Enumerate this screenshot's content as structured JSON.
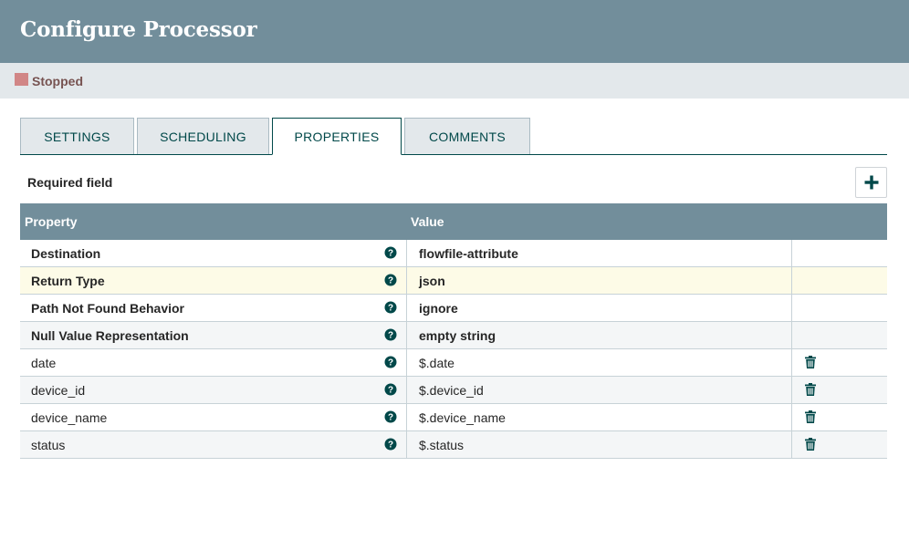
{
  "header": {
    "title": "Configure Processor"
  },
  "status": {
    "text": "Stopped",
    "color": "#d18686"
  },
  "tabs": [
    {
      "label": "SETTINGS",
      "active": false
    },
    {
      "label": "SCHEDULING",
      "active": false
    },
    {
      "label": "PROPERTIES",
      "active": true
    },
    {
      "label": "COMMENTS",
      "active": false
    }
  ],
  "properties": {
    "required_label": "Required field",
    "add_icon": "plus-icon",
    "columns": {
      "property": "Property",
      "value": "Value"
    },
    "rows": [
      {
        "name": "Destination",
        "value": "flowfile-attribute",
        "required": true,
        "deletable": false
      },
      {
        "name": "Return Type",
        "value": "json",
        "required": true,
        "deletable": false
      },
      {
        "name": "Path Not Found Behavior",
        "value": "ignore",
        "required": true,
        "deletable": false
      },
      {
        "name": "Null Value Representation",
        "value": "empty string",
        "required": true,
        "deletable": false
      },
      {
        "name": "date",
        "value": "$.date",
        "required": false,
        "deletable": true
      },
      {
        "name": "device_id",
        "value": "$.device_id",
        "required": false,
        "deletable": true
      },
      {
        "name": "device_name",
        "value": "$.device_name",
        "required": false,
        "deletable": true
      },
      {
        "name": "status",
        "value": "$.status",
        "required": false,
        "deletable": true
      }
    ]
  },
  "colors": {
    "header_bg": "#728e9b",
    "accent": "#004849",
    "status_bar_bg": "#e3e8eb",
    "highlight_row": "#fdfbe7"
  }
}
